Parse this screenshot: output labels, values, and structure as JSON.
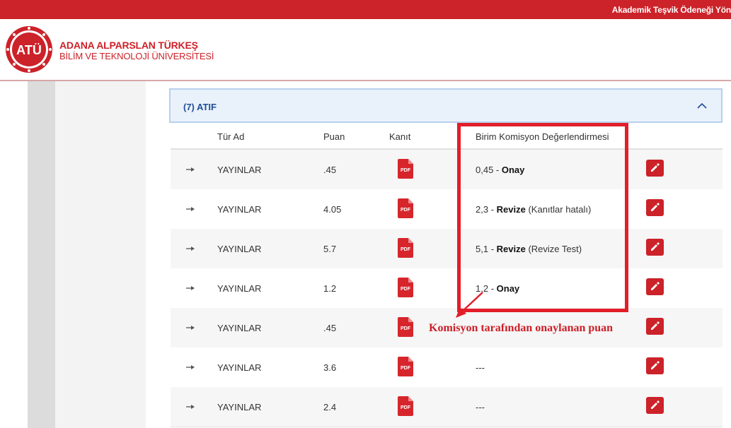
{
  "topbar": {
    "title": "Akademik Teşvik Ödeneği Yön"
  },
  "header": {
    "logo_text": "ATÜ",
    "uni_line1": "ADANA ALPARSLAN TÜRKEŞ",
    "uni_line2": "BİLİM VE TEKNOLOJİ ÜNİVERSİTESİ"
  },
  "panel": {
    "title": "(7) ATIF"
  },
  "table": {
    "headers": {
      "type": "Tür Ad",
      "score": "Puan",
      "evidence": "Kanıt",
      "committee": "Birim Komisyon Değerlendirmesi"
    },
    "rows": [
      {
        "type": "YAYINLAR",
        "score": ".45",
        "eval_score": "0,45",
        "eval_status": "Onay",
        "eval_note": ""
      },
      {
        "type": "YAYINLAR",
        "score": "4.05",
        "eval_score": "2,3",
        "eval_status": "Revize",
        "eval_note": "(Kanıtlar hatalı)"
      },
      {
        "type": "YAYINLAR",
        "score": "5.7",
        "eval_score": "5,1",
        "eval_status": "Revize",
        "eval_note": "(Revize Test)"
      },
      {
        "type": "YAYINLAR",
        "score": "1.2",
        "eval_score": "1,2",
        "eval_status": "Onay",
        "eval_note": ""
      },
      {
        "type": "YAYINLAR",
        "score": ".45",
        "eval_score": "",
        "eval_status": "",
        "eval_note": ""
      },
      {
        "type": "YAYINLAR",
        "score": "3.6",
        "eval_score": "---",
        "eval_status": "",
        "eval_note": ""
      },
      {
        "type": "YAYINLAR",
        "score": "2.4",
        "eval_score": "---",
        "eval_status": "",
        "eval_note": ""
      }
    ],
    "pdf_label": "PDF"
  },
  "annotation": {
    "text": "Komisyon tarafından onaylanan puan"
  },
  "icons": {
    "pdf": "pdf-file-icon",
    "edit": "pencil-icon",
    "arrow": "arrow-right-icon",
    "chevron": "chevron-up-icon"
  },
  "colors": {
    "brand_red": "#cc2229",
    "panel_bg": "#e9f1fb",
    "panel_text": "#1f4e96"
  }
}
